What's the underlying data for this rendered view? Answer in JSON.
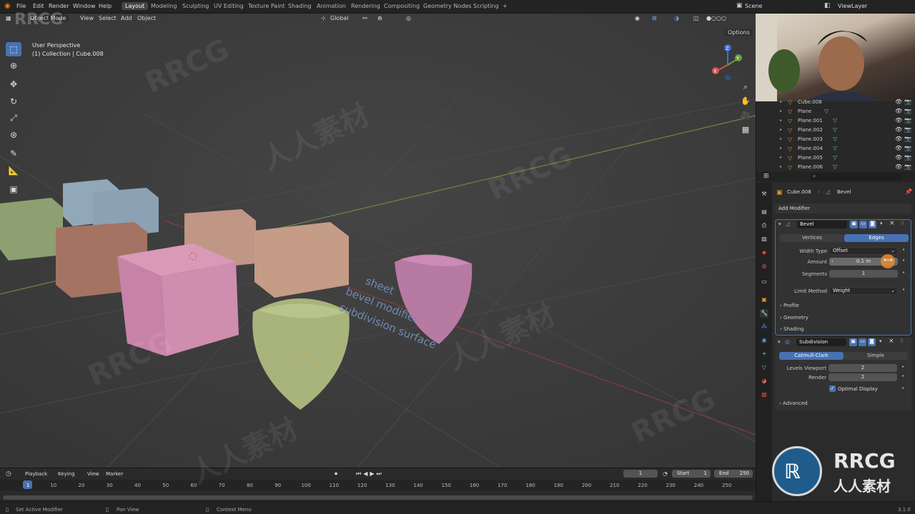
{
  "menus": [
    "File",
    "Edit",
    "Render",
    "Window",
    "Help"
  ],
  "workspaces": [
    "Layout",
    "Modeling",
    "Sculpting",
    "UV Editing",
    "Texture Paint",
    "Shading",
    "Animation",
    "Rendering",
    "Compositing",
    "Geometry Nodes",
    "Scripting"
  ],
  "active_workspace": "Layout",
  "plus": "+",
  "scene_label": "Scene",
  "viewlayer_label": "ViewLayer",
  "viewport": {
    "mode": "Object Mode",
    "menu": [
      "View",
      "Select",
      "Add",
      "Object"
    ],
    "orientation": "Global",
    "options": "Options",
    "perspective": "User Perspective",
    "collection": "(1) Collection | Cube.008",
    "annotation_lines": [
      "sheet",
      "bevel modifier",
      "subdivision surface"
    ]
  },
  "gizmo": {
    "x": "X",
    "y": "Y",
    "z": "Z"
  },
  "outliner": {
    "rows": [
      {
        "name": "Cube.008",
        "mesh": false
      },
      {
        "name": "Plane",
        "mesh": true
      },
      {
        "name": "Plane.001",
        "mesh": true
      },
      {
        "name": "Plane.002",
        "mesh": true
      },
      {
        "name": "Plane.003",
        "mesh": true
      },
      {
        "name": "Plane.004",
        "mesh": true
      },
      {
        "name": "Plane.005",
        "mesh": true
      },
      {
        "name": "Plane.006",
        "mesh": true
      }
    ]
  },
  "properties": {
    "breadcrumb_object": "Cube.008",
    "breadcrumb_modifier": "Bevel",
    "add_modifier": "Add Modifier",
    "bevel": {
      "name": "Bevel",
      "tabs": [
        "Vertices",
        "Edges"
      ],
      "active_tab": "Edges",
      "width_type_label": "Width Type",
      "width_type": "Offset",
      "amount_label": "Amount",
      "amount": "0.1 m",
      "segments_label": "Segments",
      "segments": "1",
      "limit_method_label": "Limit Method",
      "limit_method": "Weight",
      "subpanels": [
        "Profile",
        "Geometry",
        "Shading"
      ]
    },
    "subdivision": {
      "name": "Subdivision",
      "tabs": [
        "Catmull-Clark",
        "Simple"
      ],
      "active_tab": "Catmull-Clark",
      "levels_viewport_label": "Levels Viewport",
      "levels_viewport": "2",
      "render_label": "Render",
      "render": "2",
      "optimal_display": "Optimal Display",
      "optimal_display_checked": true,
      "advanced": "Advanced"
    }
  },
  "timeline": {
    "menus": [
      "Playback",
      "Keying",
      "View",
      "Marker"
    ],
    "current_frame": "1",
    "start_label": "Start",
    "start": "1",
    "end_label": "End",
    "end": "250",
    "ticks": [
      "1",
      "10",
      "20",
      "30",
      "40",
      "50",
      "60",
      "70",
      "80",
      "90",
      "100",
      "110",
      "120",
      "130",
      "140",
      "150",
      "160",
      "170",
      "180",
      "190",
      "200",
      "210",
      "220",
      "230",
      "240",
      "250"
    ]
  },
  "status": {
    "left": "Set Active Modifier",
    "middle": "Pan View",
    "right": "Context Menu",
    "version": "3.1.0"
  },
  "watermark": {
    "latin": "RRCG",
    "cjk": "人人素材"
  },
  "colors": {
    "accent": "#4772b3",
    "active_field": "#4772b3",
    "object_orange": "#e0883a",
    "mesh_green": "#5ad08a"
  }
}
